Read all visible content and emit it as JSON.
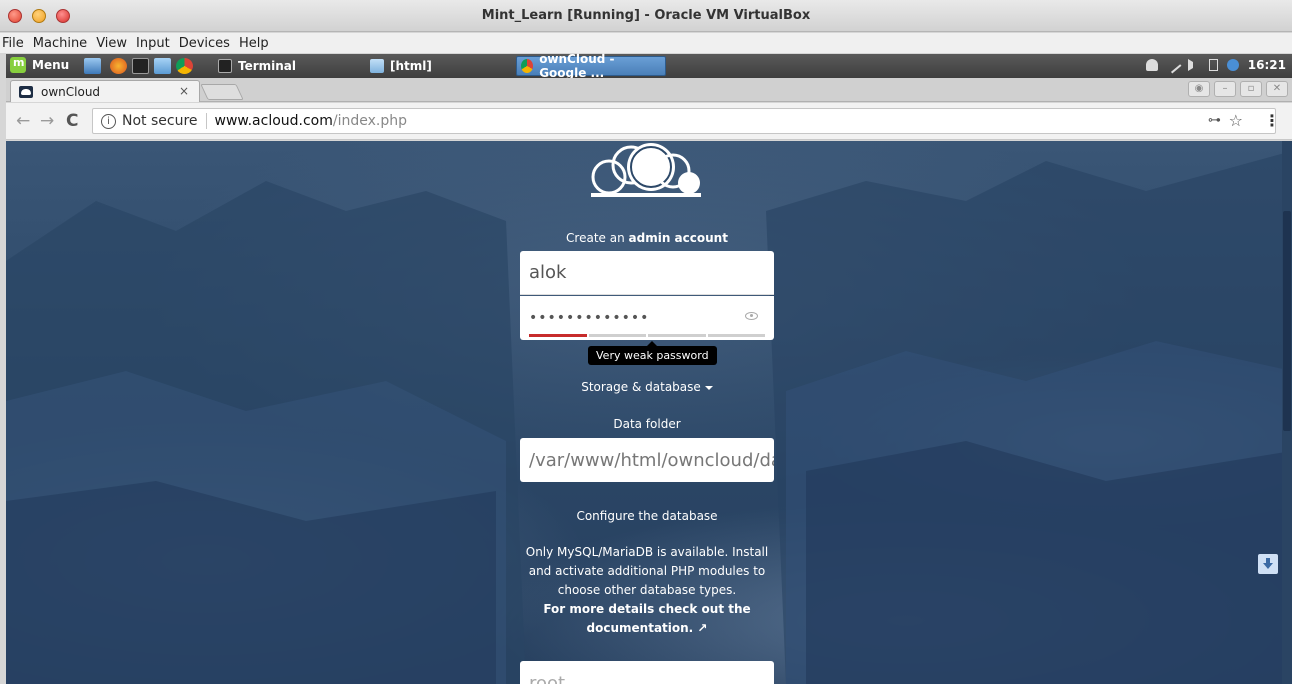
{
  "vbox": {
    "title": "Mint_Learn [Running] - Oracle VM VirtualBox",
    "menu": [
      "File",
      "Machine",
      "View",
      "Input",
      "Devices",
      "Help"
    ]
  },
  "taskbar": {
    "menu_label": "Menu",
    "tasks": [
      {
        "label": "Terminal",
        "icon": "terminal-icon"
      },
      {
        "label": "[html]",
        "icon": "folder-icon"
      },
      {
        "label": "ownCloud - Google ...",
        "icon": "chrome-icon"
      }
    ],
    "clock": "16:21"
  },
  "browser": {
    "tab_title": "ownCloud",
    "tab_close": "×",
    "security_label": "Not secure",
    "url_host": "www.acloud.com",
    "url_path": "/index.php"
  },
  "page": {
    "create_prefix": "Create an ",
    "create_bold": "admin account",
    "username_value": "alok",
    "password_mask": "•••••••••••••",
    "strength_segments_filled": 1,
    "strength_segments_total": 4,
    "strength_tooltip": "Very weak password",
    "storage_toggle": "Storage & database",
    "data_folder_label": "Data folder",
    "data_folder_value": "/var/www/html/owncloud/data",
    "configure_db_label": "Configure the database",
    "db_note_1": "Only MySQL/MariaDB is available. Install and activate additional PHP modules to choose other database types.",
    "db_note_2": "For more details check out the documentation. ↗",
    "db_user_value": "root"
  },
  "colors": {
    "background": "#2c4868",
    "strength_weak": "#c72b2b",
    "active_task": "#4a7fb8"
  }
}
